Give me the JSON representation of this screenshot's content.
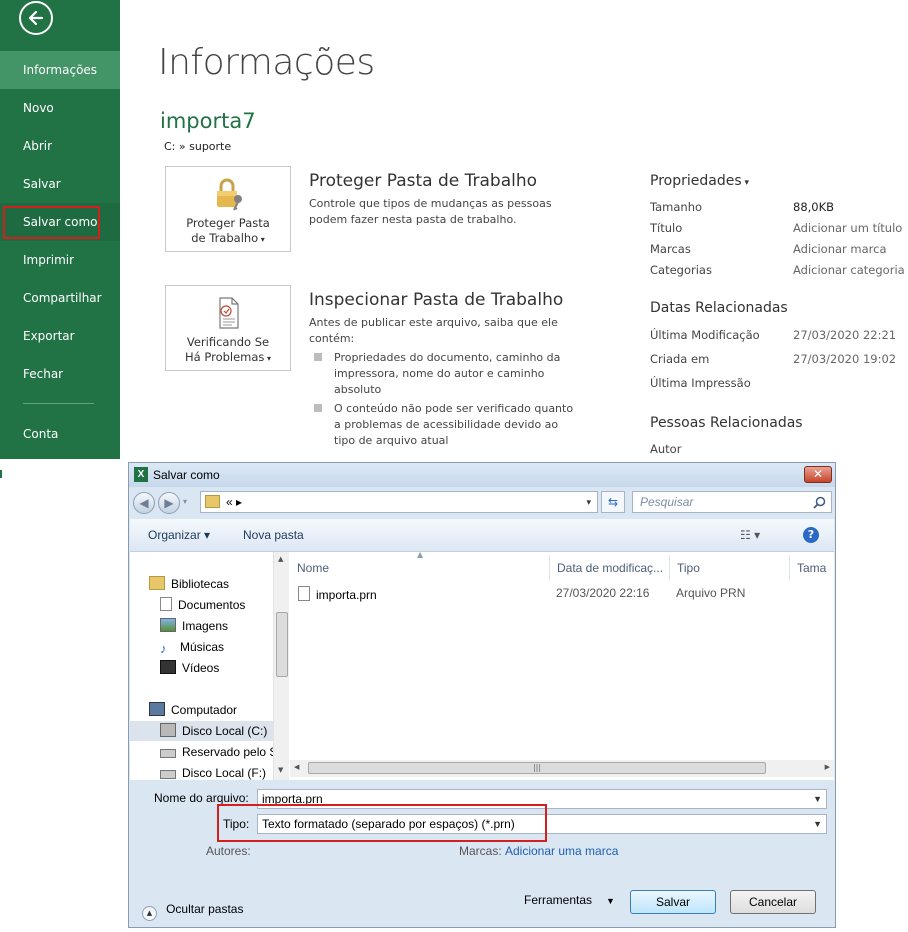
{
  "backstage": {
    "nav": {
      "informacoes": "Informações",
      "novo": "Novo",
      "abrir": "Abrir",
      "salvar": "Salvar",
      "salvar_como": "Salvar como",
      "imprimir": "Imprimir",
      "compartilhar": "Compartilhar",
      "exportar": "Exportar",
      "fechar": "Fechar",
      "conta": "Conta"
    },
    "title": "Informações",
    "file_name": "importa7",
    "file_path": "C: » suporte",
    "protect": {
      "button_line1": "Proteger Pasta",
      "button_line2": "de Trabalho",
      "heading": "Proteger Pasta de Trabalho",
      "description": "Controle que tipos de mudanças as pessoas podem fazer nesta pasta de trabalho."
    },
    "inspect": {
      "button_line1": "Verificando Se",
      "button_line2": "Há Problemas",
      "heading": "Inspecionar Pasta de Trabalho",
      "description": "Antes de publicar este arquivo, saiba que ele contém:",
      "bullets": [
        "Propriedades do documento, caminho da impressora, nome do autor e caminho absoluto",
        "O conteúdo não pode ser verificado quanto a problemas de acessibilidade devido ao tipo de arquivo atual"
      ]
    },
    "properties": {
      "title": "Propriedades",
      "rows": [
        {
          "label": "Tamanho",
          "value": "88,0KB"
        },
        {
          "label": "Título",
          "value": "Adicionar um título"
        },
        {
          "label": "Marcas",
          "value": "Adicionar marca"
        },
        {
          "label": "Categorias",
          "value": "Adicionar categoria"
        }
      ]
    },
    "dates": {
      "title": "Datas Relacionadas",
      "rows": [
        {
          "label": "Última Modificação",
          "value": "27/03/2020 22:21"
        },
        {
          "label": "Criada em",
          "value": "27/03/2020 19:02"
        },
        {
          "label": "Última Impressão",
          "value": ""
        }
      ]
    },
    "people": {
      "title": "Pessoas Relacionadas",
      "author_label": "Autor"
    }
  },
  "dialog": {
    "title": "Salvar como",
    "address": "«  ▸",
    "search_placeholder": "Pesquisar",
    "toolbar": {
      "organize": "Organizar ▾",
      "new_folder": "Nova pasta"
    },
    "tree": [
      "Bibliotecas",
      "Documentos",
      "Imagens",
      "Músicas",
      "Vídeos",
      "Computador",
      "Disco Local (C:)",
      "Reservado pelo S",
      "Disco Local (F:)"
    ],
    "columns": [
      "Nome",
      "Data de modificaç...",
      "Tipo",
      "Tama"
    ],
    "files": [
      {
        "name": "importa.prn",
        "date": "27/03/2020 22:16",
        "type": "Arquivo PRN"
      }
    ],
    "filename_label": "Nome do arquivo:",
    "filename_value": "importa.prn",
    "type_label": "Tipo:",
    "type_value": "Texto formatado (separado por espaços) (*.prn)",
    "authors_label": "Autores:",
    "tags_label": "Marcas:",
    "tags_link": "Adicionar uma marca",
    "hide_folders": "Ocultar pastas",
    "tools": "Ferramentas",
    "save": "Salvar",
    "cancel": "Cancelar"
  },
  "colors": {
    "excel_green": "#217346",
    "highlight_red": "#d3201f"
  }
}
